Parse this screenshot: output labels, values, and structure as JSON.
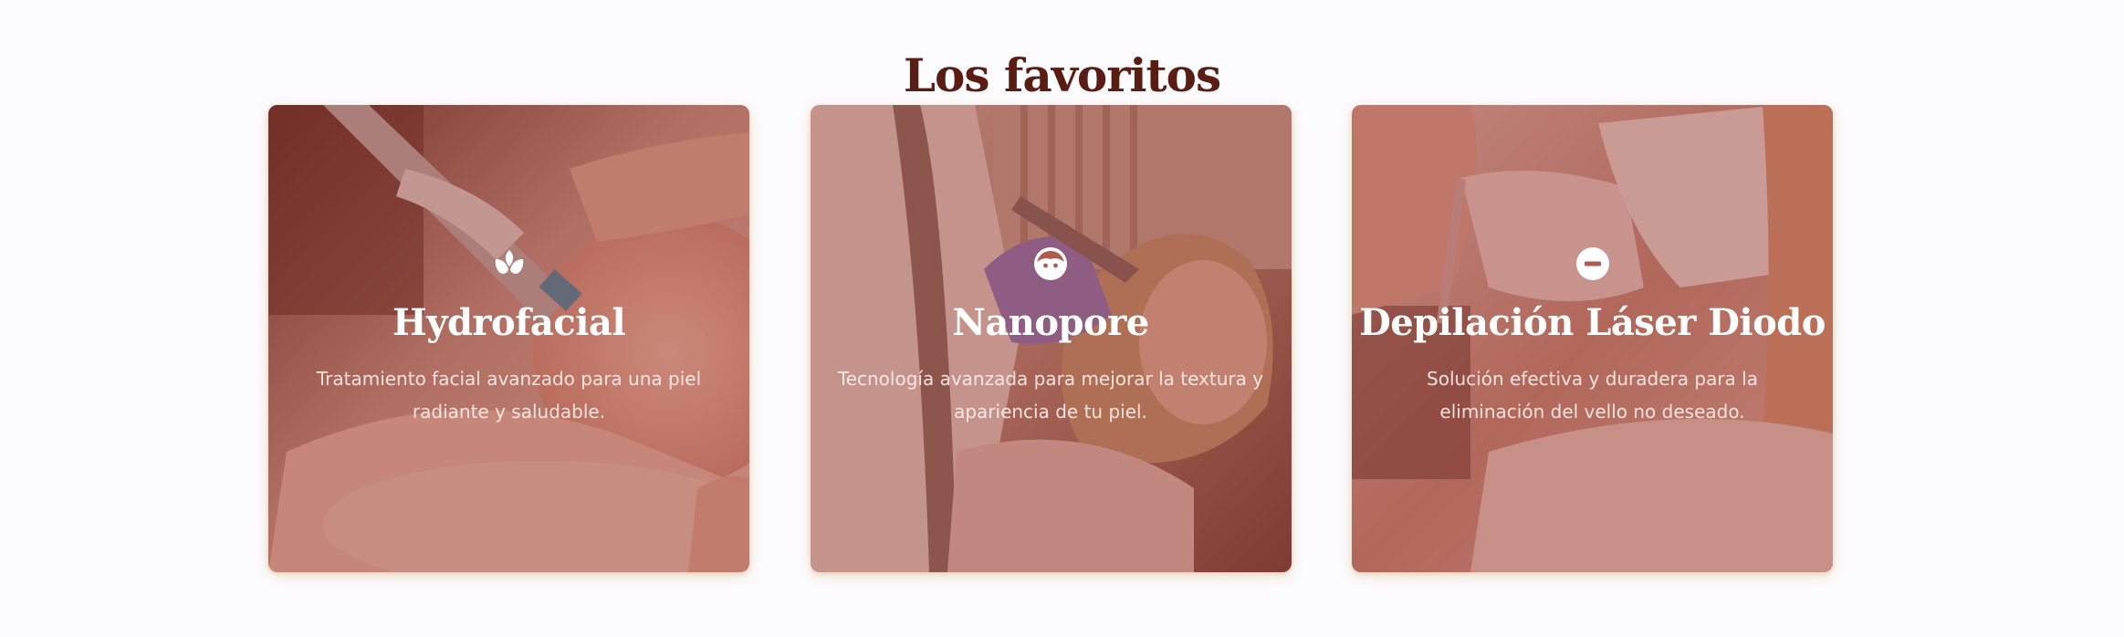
{
  "section": {
    "title": "Los favoritos"
  },
  "cards": [
    {
      "title": "Hydrofacial",
      "description": "Tratamiento facial avanzado para una piel radiante y saludable.",
      "icon": "lotus-icon",
      "image": "facial-treatment-photo"
    },
    {
      "title": "Nanopore",
      "description": "Tecnología avanzada para mejorar la textura y apariencia de tu piel.",
      "icon": "face-icon",
      "image": "scalp-treatment-photo"
    },
    {
      "title": "Depilación Láser Diodo",
      "description": "Solución efectiva y duradera para la eliminación del vello no deseado.",
      "icon": "minus-circle-icon",
      "image": "laser-hair-removal-photo"
    }
  ],
  "colors": {
    "page_background": "#fcfbfd",
    "title": "#5a1d14",
    "card_overlay": "#963c34",
    "card_text": "#ffffff"
  }
}
